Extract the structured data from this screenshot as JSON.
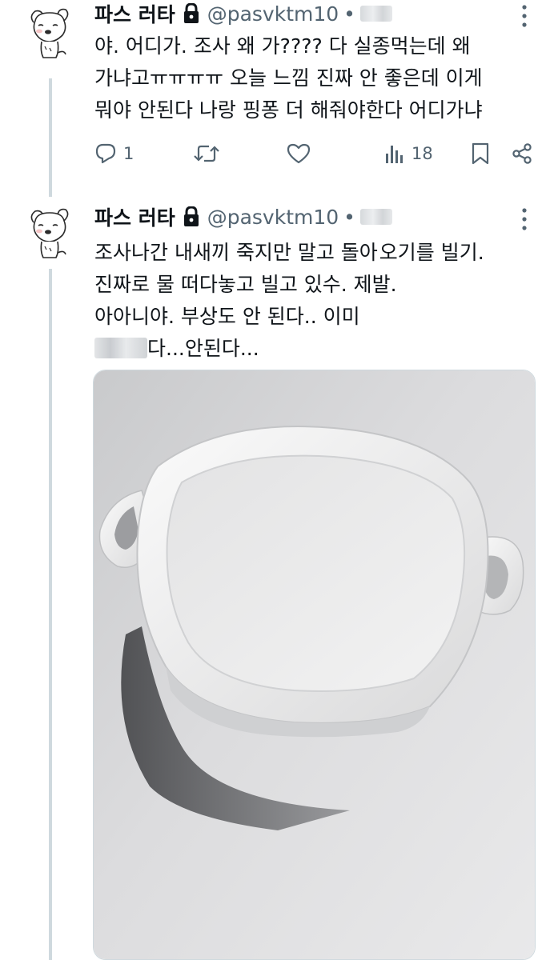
{
  "tweets": [
    {
      "author": {
        "display_name": "파스 러타",
        "handle": "@pasvktm10",
        "separator": "•",
        "protected_icon": "lock-icon",
        "avatar_icon": "dog-doodle-avatar"
      },
      "text_lines": [
        "야. 어디가. 조사 왜 가???? 다 실종먹는데 왜",
        "가냐고ㅠㅠㅠㅠ 오늘 느낌 진짜 안 좋은데 이게",
        "뭐야 안된다 나랑 핑퐁 더 해줘야한다 어디가냐"
      ],
      "actions": {
        "reply": {
          "icon": "reply-icon",
          "count": "1"
        },
        "retweet": {
          "icon": "retweet-icon"
        },
        "like": {
          "icon": "heart-icon"
        },
        "views": {
          "icon": "views-icon",
          "count": "18"
        },
        "bookmark": {
          "icon": "bookmark-icon"
        },
        "share": {
          "icon": "share-icon"
        }
      }
    },
    {
      "author": {
        "display_name": "파스 러타",
        "handle": "@pasvktm10",
        "separator": "•",
        "protected_icon": "lock-icon",
        "avatar_icon": "dog-doodle-avatar"
      },
      "text_lines": [
        {
          "before": "조사나간 내새끼 죽지만 말고 돌아",
          "after": "오기를 빌기."
        },
        "진짜로 물 떠다놓고 빌고 있수. 제발.",
        "아아니야. 부상도 안 된다.. 이미",
        {
          "after": "다...안된다..."
        }
      ],
      "media": {
        "description_icon": "white-ceramic-dish-photo"
      }
    }
  ],
  "colors": {
    "text_primary": "#0f1419",
    "text_secondary": "#536471",
    "thread_line": "#cfd9de"
  }
}
